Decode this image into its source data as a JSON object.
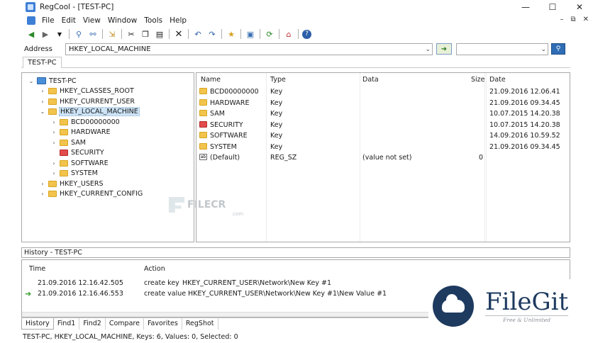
{
  "window": {
    "title": "RegCool - [TEST-PC]",
    "controls": [
      "—",
      "☐",
      "✕"
    ],
    "mdi_controls": [
      "–",
      "⧉",
      "✕"
    ]
  },
  "menu": [
    "File",
    "Edit",
    "View",
    "Window",
    "Tools",
    "Help"
  ],
  "toolbar": {
    "icons": [
      "back-icon",
      "forward-icon",
      "dropdown-icon",
      "find-icon",
      "find-replace-icon",
      "import-icon",
      "cut-icon",
      "copy-icon",
      "paste-icon",
      "delete-icon",
      "undo-icon",
      "redo-icon",
      "favorite-icon",
      "export-icon",
      "refresh-icon",
      "home-icon",
      "help-icon"
    ]
  },
  "address": {
    "label": "Address",
    "value": "HKEY_LOCAL_MACHINE",
    "search_value": ""
  },
  "tab": "TEST-PC",
  "tree": [
    {
      "label": "TEST-PC",
      "level": 0,
      "expander": "⌄",
      "type": "computer"
    },
    {
      "label": "HKEY_CLASSES_ROOT",
      "level": 1,
      "expander": "›",
      "type": "folder"
    },
    {
      "label": "HKEY_CURRENT_USER",
      "level": 1,
      "expander": "›",
      "type": "folder"
    },
    {
      "label": "HKEY_LOCAL_MACHINE",
      "level": 1,
      "expander": "⌄",
      "type": "folder",
      "selected": true
    },
    {
      "label": "BCD00000000",
      "level": 2,
      "expander": "›",
      "type": "folder"
    },
    {
      "label": "HARDWARE",
      "level": 2,
      "expander": "›",
      "type": "folder"
    },
    {
      "label": "SAM",
      "level": 2,
      "expander": "›",
      "type": "folder"
    },
    {
      "label": "SECURITY",
      "level": 2,
      "expander": "",
      "type": "red"
    },
    {
      "label": "SOFTWARE",
      "level": 2,
      "expander": "›",
      "type": "folder"
    },
    {
      "label": "SYSTEM",
      "level": 2,
      "expander": "›",
      "type": "folder"
    },
    {
      "label": "HKEY_USERS",
      "level": 1,
      "expander": "›",
      "type": "folder"
    },
    {
      "label": "HKEY_CURRENT_CONFIG",
      "level": 1,
      "expander": "›",
      "type": "folder"
    }
  ],
  "list": {
    "columns": [
      "Name",
      "Type",
      "Data",
      "Size",
      "Date"
    ],
    "rows": [
      {
        "name": "BCD00000000",
        "type": "Key",
        "data": "",
        "size": "",
        "date": "21.09.2016 12.06.41",
        "icon": "folder"
      },
      {
        "name": "HARDWARE",
        "type": "Key",
        "data": "",
        "size": "",
        "date": "21.09.2016 09.34.45",
        "icon": "folder"
      },
      {
        "name": "SAM",
        "type": "Key",
        "data": "",
        "size": "",
        "date": "10.07.2015 14.20.38",
        "icon": "folder"
      },
      {
        "name": "SECURITY",
        "type": "Key",
        "data": "",
        "size": "",
        "date": "10.07.2015 14.20.38",
        "icon": "red"
      },
      {
        "name": "SOFTWARE",
        "type": "Key",
        "data": "",
        "size": "",
        "date": "14.09.2016 10.59.52",
        "icon": "folder"
      },
      {
        "name": "SYSTEM",
        "type": "Key",
        "data": "",
        "size": "",
        "date": "21.09.2016 09.34.45",
        "icon": "folder"
      },
      {
        "name": "(Default)",
        "type": "REG_SZ",
        "data": "(value not set)",
        "size": "0",
        "date": "",
        "icon": "ab"
      }
    ]
  },
  "history": {
    "title": "History - TEST-PC",
    "columns": [
      "Time",
      "Action"
    ],
    "rows": [
      {
        "time": "21.09.2016 12.16.42.505",
        "action": "create key",
        "path": "HKEY_CURRENT_USER\\Network\\New Key #1",
        "current": false
      },
      {
        "time": "21.09.2016 12.16.46.553",
        "action": "create value",
        "path": "HKEY_CURRENT_USER\\Network\\New Key #1\\New Value #1",
        "current": true
      }
    ]
  },
  "bottom_tabs": [
    "History",
    "Find1",
    "Find2",
    "Compare",
    "Favorites",
    "RegShot"
  ],
  "status": "TEST-PC, HKEY_LOCAL_MACHINE, Keys: 6, Values: 0, Selected: 0",
  "watermarks": {
    "filecr": "FILECR",
    "filecr_sub": ".com",
    "filegit": "FileGit",
    "filegit_tag": "Free & Unlimited"
  }
}
